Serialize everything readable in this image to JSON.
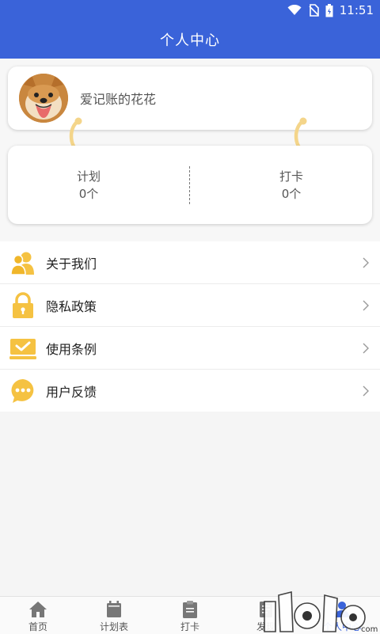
{
  "status_bar": {
    "time": "11:51",
    "icons": [
      "wifi-icon",
      "no-sim-icon",
      "battery-icon"
    ]
  },
  "header": {
    "title": "个人中心"
  },
  "profile": {
    "username": "爱记账的花花",
    "avatar": "shiba-dog-avatar"
  },
  "stats": {
    "plan": {
      "label": "计划",
      "value": "0个"
    },
    "checkin": {
      "label": "打卡",
      "value": "0个"
    }
  },
  "menu": [
    {
      "label": "关于我们",
      "icon": "users-icon"
    },
    {
      "label": "隐私政策",
      "icon": "lock-icon"
    },
    {
      "label": "使用条例",
      "icon": "checkmark-laptop-icon"
    },
    {
      "label": "用户反馈",
      "icon": "chat-bubble-icon"
    }
  ],
  "nav": [
    {
      "label": "首页",
      "icon": "home-icon"
    },
    {
      "label": "计划表",
      "icon": "calendar-icon"
    },
    {
      "label": "打卡",
      "icon": "clipboard-icon"
    },
    {
      "label": "发现",
      "icon": "discover-icon"
    },
    {
      "label": "个人中心",
      "icon": "person-icon",
      "active": true
    }
  ],
  "colors": {
    "primary": "#3a63d9",
    "accent_yellow": "#f5c242",
    "hook_yellow": "#f4d58a"
  }
}
